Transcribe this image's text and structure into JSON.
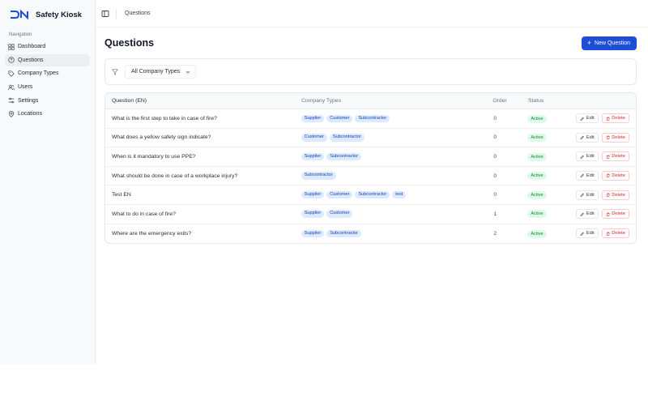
{
  "brand": {
    "title": "Safety Kiosk"
  },
  "sidebar": {
    "heading": "Navigation",
    "items": [
      {
        "label": "Dashboard",
        "icon": "grid-icon"
      },
      {
        "label": "Questions",
        "icon": "help-circle-icon",
        "active": true
      },
      {
        "label": "Company Types",
        "icon": "tag-icon"
      },
      {
        "label": "Users",
        "icon": "users-icon"
      },
      {
        "label": "Settings",
        "icon": "sliders-icon"
      },
      {
        "label": "Locations",
        "icon": "map-pin-icon"
      }
    ]
  },
  "topbar": {
    "breadcrumb": "Questions"
  },
  "page": {
    "title": "Questions",
    "new_button": "New Question"
  },
  "filter": {
    "selected": "All Company Types"
  },
  "table": {
    "headers": {
      "question": "Question (EN)",
      "types": "Company Types",
      "order": "Order",
      "status": "Status"
    },
    "edit_label": "Edit",
    "delete_label": "Delete",
    "rows": [
      {
        "question": "What is the first step to take in case of fire?",
        "types": [
          "Supplier",
          "Customer",
          "Subcontractor"
        ],
        "order": "0",
        "status": "Active"
      },
      {
        "question": "What does a yellow safety sign indicate?",
        "types": [
          "Customer",
          "Subcontractor"
        ],
        "order": "0",
        "status": "Active"
      },
      {
        "question": "When is it mandatory to use PPE?",
        "types": [
          "Supplier",
          "Subcontractor"
        ],
        "order": "0",
        "status": "Active"
      },
      {
        "question": "What should be done in case of a workplace injury?",
        "types": [
          "Subcontractor"
        ],
        "order": "0",
        "status": "Active"
      },
      {
        "question": "Test EN",
        "types": [
          "Supplier",
          "Customer",
          "Subcontractor",
          "test"
        ],
        "order": "0",
        "status": "Active"
      },
      {
        "question": "What to do in case of fire?",
        "types": [
          "Supplier",
          "Customer"
        ],
        "order": "1",
        "status": "Active"
      },
      {
        "question": "Where are the emergency exits?",
        "types": [
          "Supplier",
          "Subcontractor"
        ],
        "order": "2",
        "status": "Active"
      }
    ]
  },
  "colors": {
    "accent": "#1d4ed8",
    "tag_bg": "#dbeafe",
    "status_bg": "#dcfce7",
    "danger": "#dc2626"
  }
}
